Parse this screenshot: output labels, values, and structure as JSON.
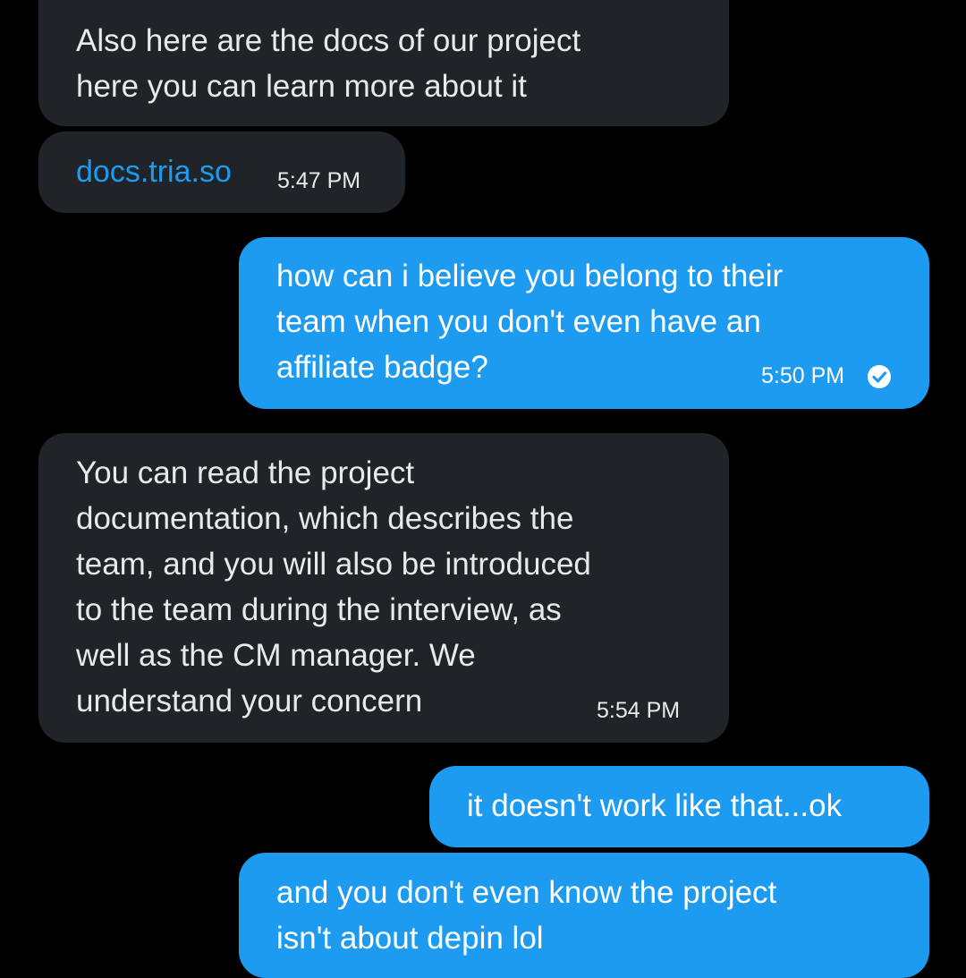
{
  "colors": {
    "background": "#000000",
    "incoming_bubble": "#202327",
    "outgoing_bubble": "#1d9bf0",
    "link": "#1d9bf0",
    "text": "#e7e9ea"
  },
  "messages": [
    {
      "direction": "incoming",
      "text": "Also here are the docs of our project\nhere you can learn more about it"
    },
    {
      "direction": "incoming",
      "link_text": "docs.tria.so",
      "time": "5:47 PM"
    },
    {
      "direction": "outgoing",
      "text": "how can i believe you belong to their\nteam when you don't even have an\naffiliate badge?",
      "time": "5:50 PM",
      "status_icon": "check-circle-icon"
    },
    {
      "direction": "incoming",
      "text": "You can read the project\ndocumentation, which describes the\nteam, and you will also be introduced\nto the team during the interview, as\nwell as the CM manager. We\nunderstand your concern",
      "time": "5:54 PM"
    },
    {
      "direction": "outgoing",
      "text": "it doesn't work like that...ok"
    },
    {
      "direction": "outgoing",
      "text": "and you don't even know the project\nisn't about depin lol"
    }
  ]
}
